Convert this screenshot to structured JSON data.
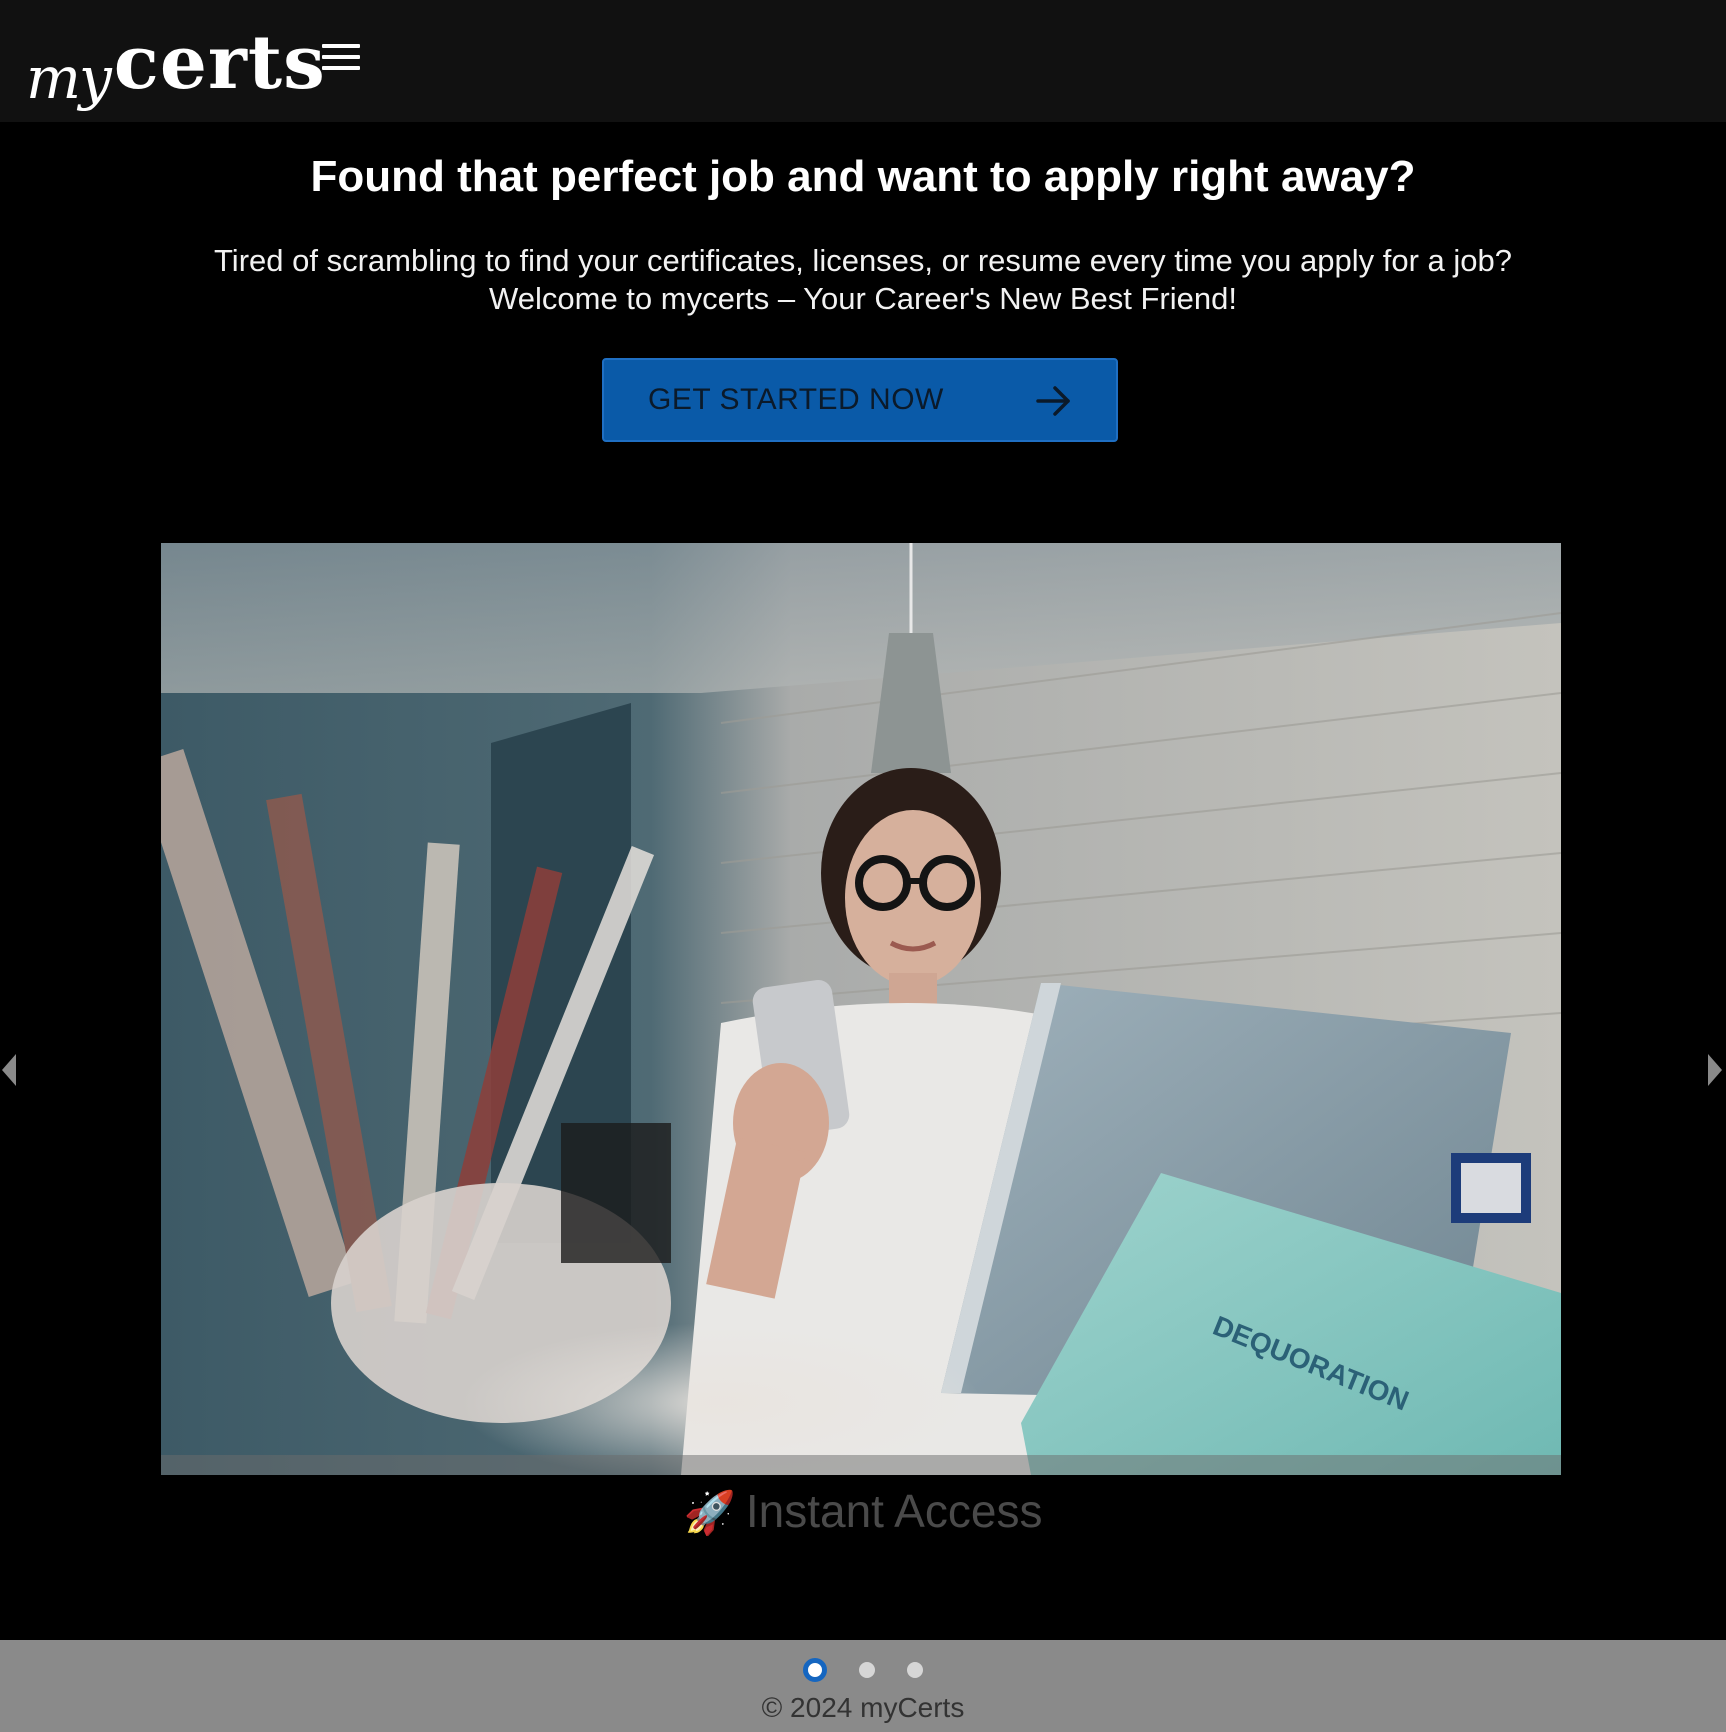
{
  "header": {
    "logo_script": "my",
    "logo_bold": "certs",
    "menu_icon": "hamburger-menu-icon"
  },
  "hero": {
    "title": "Found that perfect job and want to apply right away?",
    "subtitle_line1": "Tired of scrambling to find your certificates, licenses, or resume every time you apply for a job?",
    "subtitle_line2": "Welcome to mycerts – Your Career's New Best Friend!",
    "cta_label": "GET STARTED NOW",
    "cta_icon": "arrow-right-icon"
  },
  "carousel": {
    "prev_icon": "caret-left-icon",
    "next_icon": "caret-right-icon",
    "active_index": 0,
    "slides": [
      {
        "icon": "🚀",
        "caption": "Instant Access"
      }
    ],
    "dot_count": 3
  },
  "footer": {
    "copyright": "© 2024 myCerts"
  },
  "colors": {
    "header_bg": "#111111",
    "page_bg": "#000000",
    "cta_bg": "#0a5aa8",
    "footer_bg": "#8a8a8a",
    "active_dot": "#1566c0"
  }
}
